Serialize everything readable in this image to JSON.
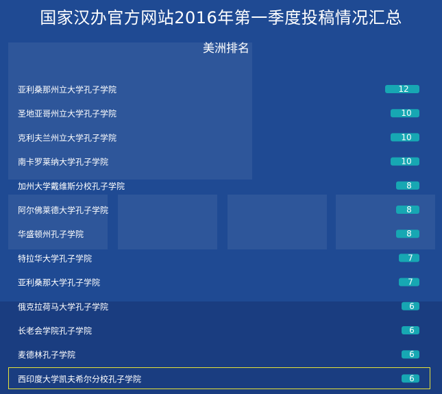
{
  "header": {
    "title": "国家汉办官方网站2016年第一季度投稿情况汇总",
    "subtitle": "美洲排名"
  },
  "colors": {
    "background": "#1f4a93",
    "bar": "#17a7b3",
    "text": "#ffffff",
    "highlight": "#e8e337"
  },
  "chart_data": {
    "type": "bar",
    "orientation": "horizontal",
    "title": "国家汉办官方网站2016年第一季度投稿情况汇总",
    "subtitle": "美洲排名",
    "xlabel": "",
    "ylabel": "",
    "xlim": [
      0,
      12
    ],
    "grid": false,
    "categories": [
      "亚利桑那州立大学孔子学院",
      "圣地亚哥州立大学孔子学院",
      "克利夫兰州立大学孔子学院",
      "南卡罗莱纳大学孔子学院",
      "加州大学戴维斯分校孔子学院",
      "阿尔佛莱德大学孔子学院",
      "华盛顿州孔子学院",
      "特拉华大学孔子学院",
      "亚利桑那大学孔子学院",
      "俄克拉荷马大学孔子学院",
      "长老会学院孔子学院",
      "麦德林孔子学院",
      "西印度大学凯夫希尔分校孔子学院"
    ],
    "values": [
      12,
      10,
      10,
      10,
      8,
      8,
      8,
      7,
      7,
      6,
      6,
      6,
      6
    ],
    "highlighted_category": "西印度大学凯夫希尔分校孔子学院"
  }
}
